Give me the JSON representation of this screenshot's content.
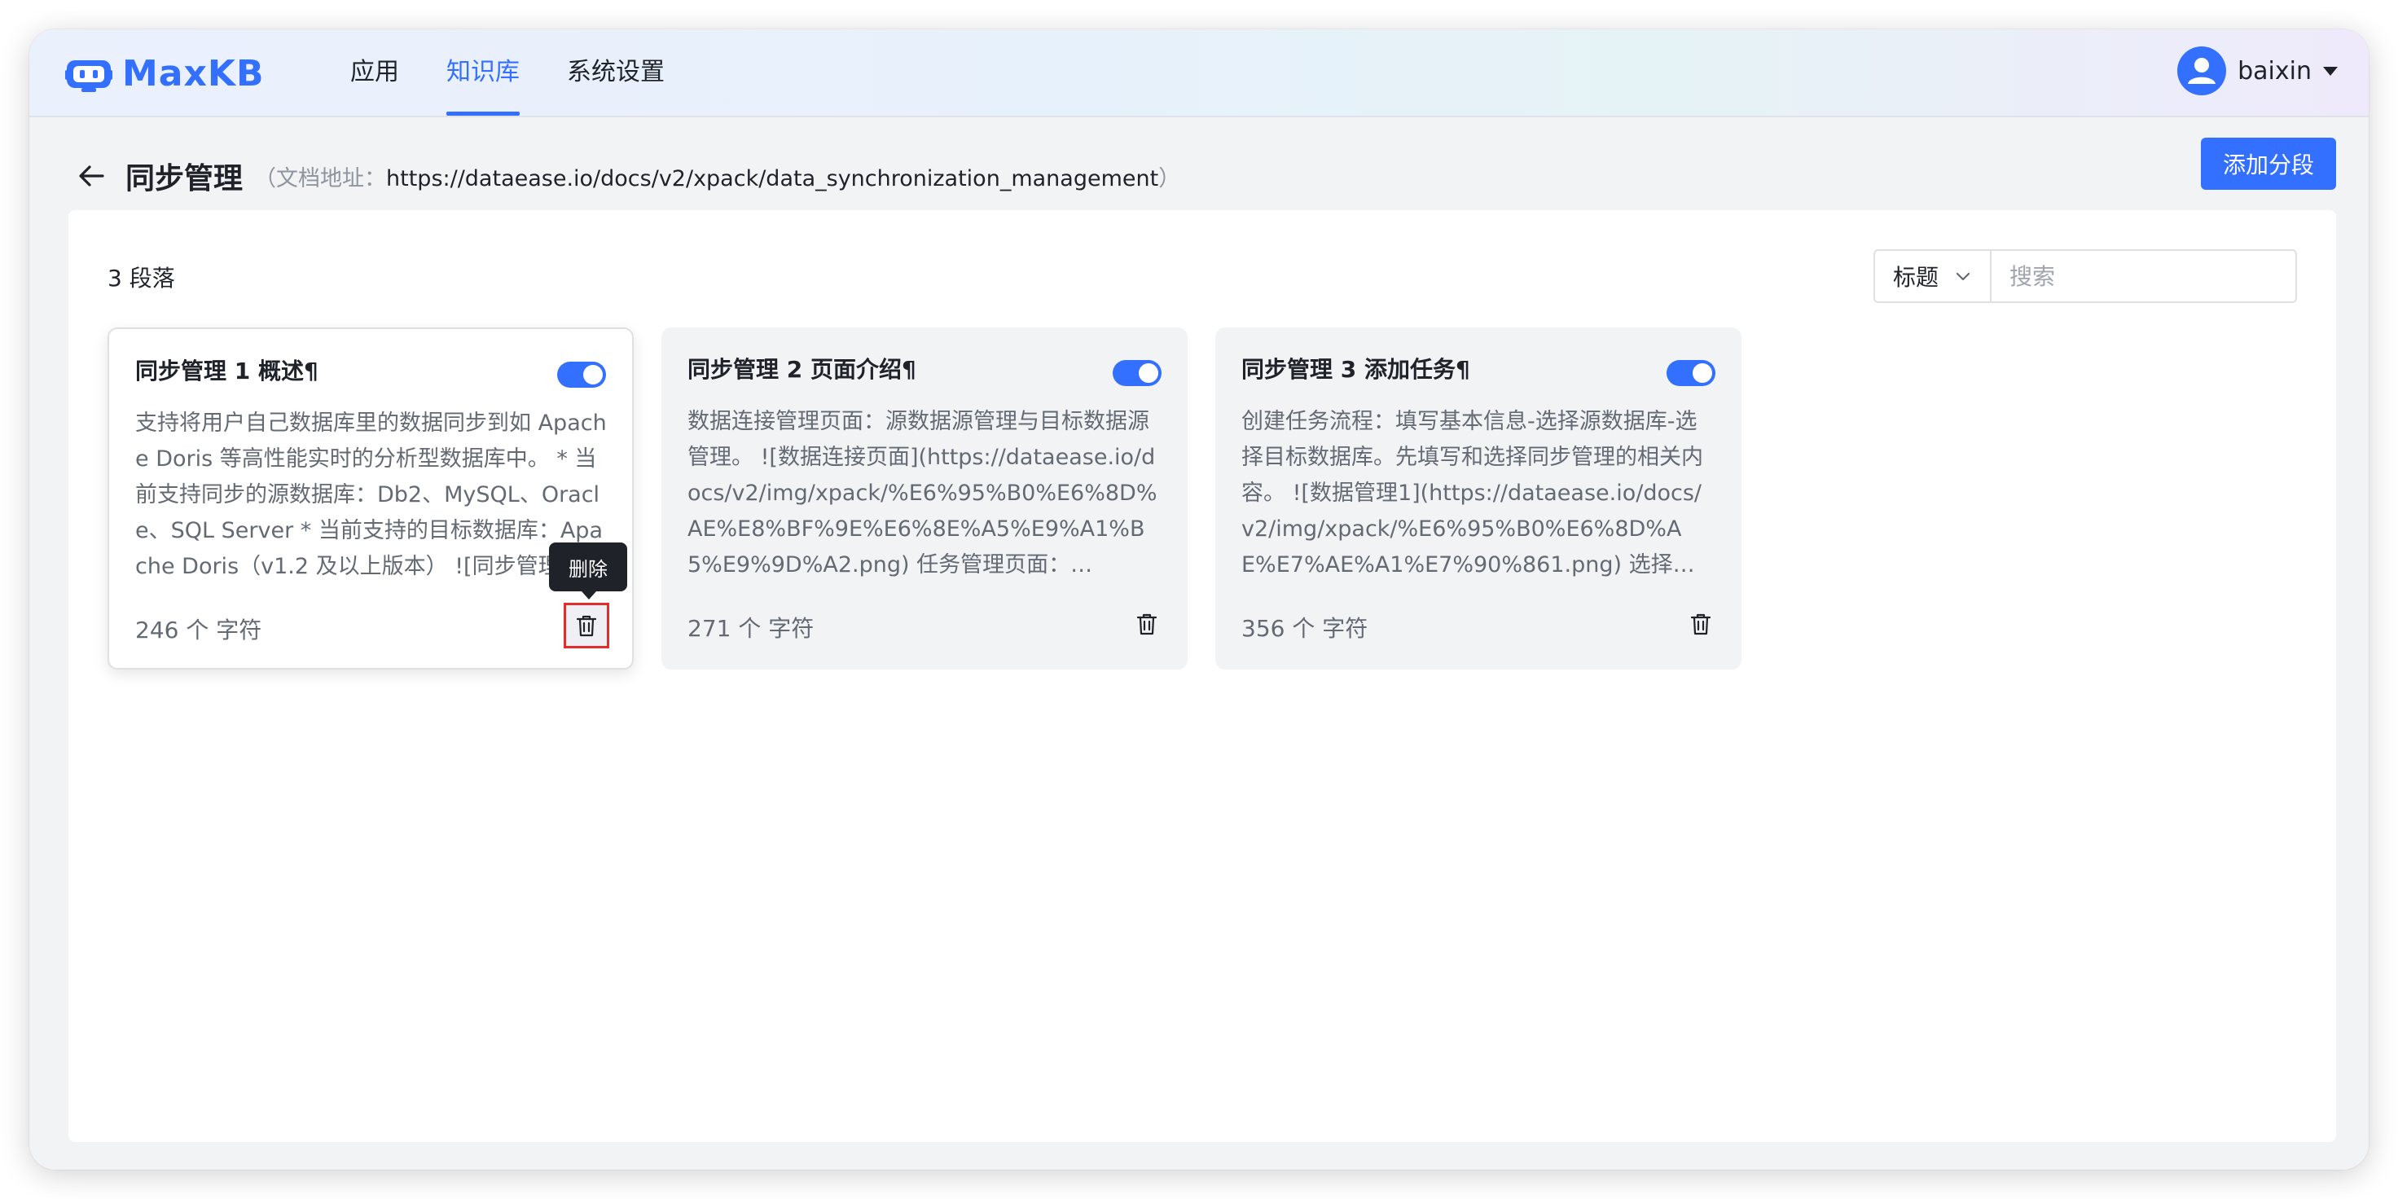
{
  "app": {
    "logo_text": "MaxKB",
    "brand_color": "#3370ff"
  },
  "nav": {
    "items": [
      {
        "label": "应用",
        "active": false
      },
      {
        "label": "知识库",
        "active": true
      },
      {
        "label": "系统设置",
        "active": false
      }
    ]
  },
  "user": {
    "name": "baixin"
  },
  "page": {
    "title": "同步管理",
    "doc_prefix": "（文档地址：",
    "doc_url": "https://dataease.io/docs/v2/xpack/data_synchronization_management",
    "doc_suffix": "）",
    "add_button": "添加分段"
  },
  "toolbar": {
    "count_label": "3 段落",
    "search_field": "标题",
    "search_placeholder": "搜索"
  },
  "cards": [
    {
      "title": "同步管理 1 概述¶",
      "enabled": true,
      "content": "支持将用户自己数据库里的数据同步到如 Apache Doris 等高性能实时的分析型数据库中。 * 当前支持同步的源数据库：Db2、MySQL、Oracle、SQL Server * 当前支持的目标数据库：Apache Doris（v1.2 及以上版本） ![同步管理",
      "char_count": "246 个 字符"
    },
    {
      "title": "同步管理 2 页面介绍¶",
      "enabled": true,
      "content": "数据连接管理页面：源数据源管理与目标数据源管理。 ![数据连接页面](https://dataease.io/docs/v2/img/xpack/%E6%95%B0%E6%8D%AE%E8%BF%9E%E6%8E%A5%E9%A1%B5%E9%9D%A2.png) 任务管理页面：…",
      "char_count": "271 个 字符"
    },
    {
      "title": "同步管理 3 添加任务¶",
      "enabled": true,
      "content": "创建任务流程：填写基本信息-选择源数据库-选择目标数据库。先填写和选择同步管理的相关内容。 ![数据管理1](https://dataease.io/docs/v2/img/xpack/%E6%95%B0%E6%8D%AE%E7%AE%A1%E7%90%861.png) 选择…",
      "char_count": "356 个 字符"
    }
  ],
  "tooltip": {
    "text": "删除"
  }
}
